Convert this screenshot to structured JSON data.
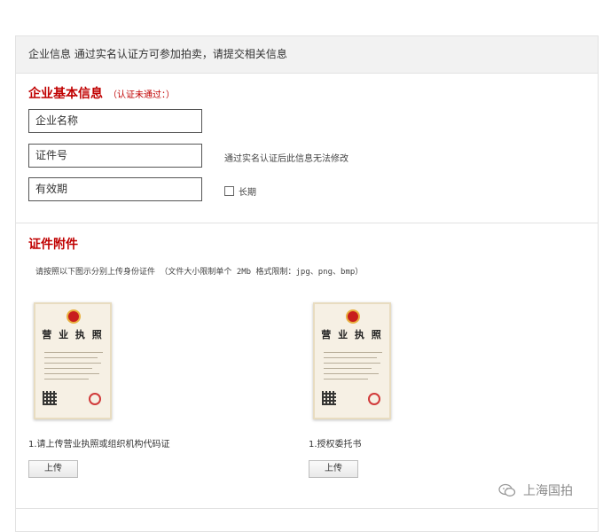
{
  "header": {
    "text": "企业信息 通过实名认证方可参加拍卖，请提交相关信息"
  },
  "basic_info": {
    "title": "企业基本信息",
    "status_note": "（认证未通过：）",
    "company_name_placeholder": "企业名称",
    "cert_number_placeholder": "证件号",
    "validity_placeholder": "有效期",
    "cannot_modify_hint": "通过实名认证后此信息无法修改",
    "long_term_label": "长期"
  },
  "attachments": {
    "title": "证件附件",
    "instruction": "请按照以下图示分别上传身份证件 （文件大小限制单个 2Mb 格式限制：jpg、png、bmp）",
    "items": [
      {
        "label": "1.请上传营业执照或组织机构代码证",
        "button": "上传",
        "image_title": "营 业 执 照"
      },
      {
        "label": "1.授权委托书",
        "button": "上传",
        "image_title": "营 业 执 照"
      }
    ]
  },
  "watermark": {
    "text": "上海国拍"
  }
}
